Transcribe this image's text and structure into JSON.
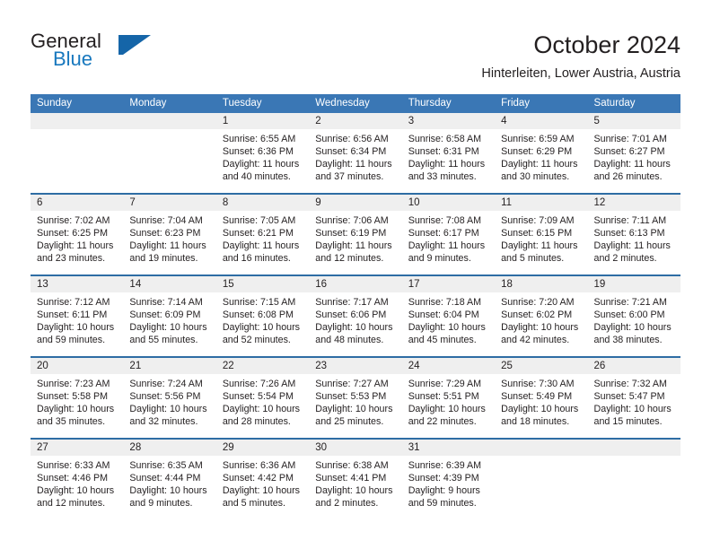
{
  "brand": {
    "name_part1": "General",
    "name_part2": "Blue",
    "mark": "triangle-logo"
  },
  "header": {
    "title": "October 2024",
    "subtitle": "Hinterleiten, Lower Austria, Austria"
  },
  "colors": {
    "header_blue": "#3a77b5",
    "separator_blue": "#2e6da4",
    "daynum_band": "#efefef",
    "brand_blue": "#1878be",
    "text": "#231f20"
  },
  "weekdays": [
    "Sunday",
    "Monday",
    "Tuesday",
    "Wednesday",
    "Thursday",
    "Friday",
    "Saturday"
  ],
  "weeks": [
    {
      "days": [
        {
          "num": "",
          "lines": []
        },
        {
          "num": "",
          "lines": []
        },
        {
          "num": "1",
          "lines": [
            "Sunrise: 6:55 AM",
            "Sunset: 6:36 PM",
            "Daylight: 11 hours",
            "and 40 minutes."
          ]
        },
        {
          "num": "2",
          "lines": [
            "Sunrise: 6:56 AM",
            "Sunset: 6:34 PM",
            "Daylight: 11 hours",
            "and 37 minutes."
          ]
        },
        {
          "num": "3",
          "lines": [
            "Sunrise: 6:58 AM",
            "Sunset: 6:31 PM",
            "Daylight: 11 hours",
            "and 33 minutes."
          ]
        },
        {
          "num": "4",
          "lines": [
            "Sunrise: 6:59 AM",
            "Sunset: 6:29 PM",
            "Daylight: 11 hours",
            "and 30 minutes."
          ]
        },
        {
          "num": "5",
          "lines": [
            "Sunrise: 7:01 AM",
            "Sunset: 6:27 PM",
            "Daylight: 11 hours",
            "and 26 minutes."
          ]
        }
      ]
    },
    {
      "days": [
        {
          "num": "6",
          "lines": [
            "Sunrise: 7:02 AM",
            "Sunset: 6:25 PM",
            "Daylight: 11 hours",
            "and 23 minutes."
          ]
        },
        {
          "num": "7",
          "lines": [
            "Sunrise: 7:04 AM",
            "Sunset: 6:23 PM",
            "Daylight: 11 hours",
            "and 19 minutes."
          ]
        },
        {
          "num": "8",
          "lines": [
            "Sunrise: 7:05 AM",
            "Sunset: 6:21 PM",
            "Daylight: 11 hours",
            "and 16 minutes."
          ]
        },
        {
          "num": "9",
          "lines": [
            "Sunrise: 7:06 AM",
            "Sunset: 6:19 PM",
            "Daylight: 11 hours",
            "and 12 minutes."
          ]
        },
        {
          "num": "10",
          "lines": [
            "Sunrise: 7:08 AM",
            "Sunset: 6:17 PM",
            "Daylight: 11 hours",
            "and 9 minutes."
          ]
        },
        {
          "num": "11",
          "lines": [
            "Sunrise: 7:09 AM",
            "Sunset: 6:15 PM",
            "Daylight: 11 hours",
            "and 5 minutes."
          ]
        },
        {
          "num": "12",
          "lines": [
            "Sunrise: 7:11 AM",
            "Sunset: 6:13 PM",
            "Daylight: 11 hours",
            "and 2 minutes."
          ]
        }
      ]
    },
    {
      "days": [
        {
          "num": "13",
          "lines": [
            "Sunrise: 7:12 AM",
            "Sunset: 6:11 PM",
            "Daylight: 10 hours",
            "and 59 minutes."
          ]
        },
        {
          "num": "14",
          "lines": [
            "Sunrise: 7:14 AM",
            "Sunset: 6:09 PM",
            "Daylight: 10 hours",
            "and 55 minutes."
          ]
        },
        {
          "num": "15",
          "lines": [
            "Sunrise: 7:15 AM",
            "Sunset: 6:08 PM",
            "Daylight: 10 hours",
            "and 52 minutes."
          ]
        },
        {
          "num": "16",
          "lines": [
            "Sunrise: 7:17 AM",
            "Sunset: 6:06 PM",
            "Daylight: 10 hours",
            "and 48 minutes."
          ]
        },
        {
          "num": "17",
          "lines": [
            "Sunrise: 7:18 AM",
            "Sunset: 6:04 PM",
            "Daylight: 10 hours",
            "and 45 minutes."
          ]
        },
        {
          "num": "18",
          "lines": [
            "Sunrise: 7:20 AM",
            "Sunset: 6:02 PM",
            "Daylight: 10 hours",
            "and 42 minutes."
          ]
        },
        {
          "num": "19",
          "lines": [
            "Sunrise: 7:21 AM",
            "Sunset: 6:00 PM",
            "Daylight: 10 hours",
            "and 38 minutes."
          ]
        }
      ]
    },
    {
      "days": [
        {
          "num": "20",
          "lines": [
            "Sunrise: 7:23 AM",
            "Sunset: 5:58 PM",
            "Daylight: 10 hours",
            "and 35 minutes."
          ]
        },
        {
          "num": "21",
          "lines": [
            "Sunrise: 7:24 AM",
            "Sunset: 5:56 PM",
            "Daylight: 10 hours",
            "and 32 minutes."
          ]
        },
        {
          "num": "22",
          "lines": [
            "Sunrise: 7:26 AM",
            "Sunset: 5:54 PM",
            "Daylight: 10 hours",
            "and 28 minutes."
          ]
        },
        {
          "num": "23",
          "lines": [
            "Sunrise: 7:27 AM",
            "Sunset: 5:53 PM",
            "Daylight: 10 hours",
            "and 25 minutes."
          ]
        },
        {
          "num": "24",
          "lines": [
            "Sunrise: 7:29 AM",
            "Sunset: 5:51 PM",
            "Daylight: 10 hours",
            "and 22 minutes."
          ]
        },
        {
          "num": "25",
          "lines": [
            "Sunrise: 7:30 AM",
            "Sunset: 5:49 PM",
            "Daylight: 10 hours",
            "and 18 minutes."
          ]
        },
        {
          "num": "26",
          "lines": [
            "Sunrise: 7:32 AM",
            "Sunset: 5:47 PM",
            "Daylight: 10 hours",
            "and 15 minutes."
          ]
        }
      ]
    },
    {
      "days": [
        {
          "num": "27",
          "lines": [
            "Sunrise: 6:33 AM",
            "Sunset: 4:46 PM",
            "Daylight: 10 hours",
            "and 12 minutes."
          ]
        },
        {
          "num": "28",
          "lines": [
            "Sunrise: 6:35 AM",
            "Sunset: 4:44 PM",
            "Daylight: 10 hours",
            "and 9 minutes."
          ]
        },
        {
          "num": "29",
          "lines": [
            "Sunrise: 6:36 AM",
            "Sunset: 4:42 PM",
            "Daylight: 10 hours",
            "and 5 minutes."
          ]
        },
        {
          "num": "30",
          "lines": [
            "Sunrise: 6:38 AM",
            "Sunset: 4:41 PM",
            "Daylight: 10 hours",
            "and 2 minutes."
          ]
        },
        {
          "num": "31",
          "lines": [
            "Sunrise: 6:39 AM",
            "Sunset: 4:39 PM",
            "Daylight: 9 hours",
            "and 59 minutes."
          ]
        },
        {
          "num": "",
          "lines": []
        },
        {
          "num": "",
          "lines": []
        }
      ]
    }
  ]
}
